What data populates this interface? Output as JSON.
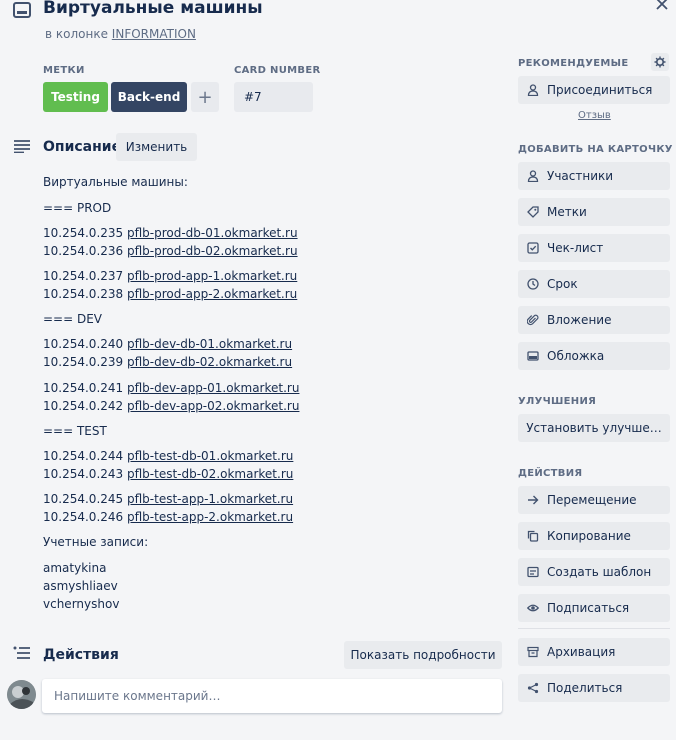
{
  "card": {
    "title": "Виртуальные машины",
    "list_prefix": "в колонке",
    "list_name": "INFORMATION"
  },
  "labels": {
    "header": "МЕТКИ",
    "items": [
      {
        "text": "Testing",
        "color": "#61bd4f"
      },
      {
        "text": "Back-end",
        "color": "#344563"
      }
    ],
    "add_symbol": "+"
  },
  "card_number": {
    "header": "CARD NUMBER",
    "value": "#7"
  },
  "description": {
    "title": "Описание",
    "edit_label": "Изменить",
    "intro": "Виртуальные машины:",
    "groups": [
      {
        "heading": "=== PROD",
        "blocks": [
          [
            {
              "ip": "10.254.0.235",
              "host": "pflb-prod-db-01.okmarket.ru"
            },
            {
              "ip": "10.254.0.236",
              "host": "pflb-prod-db-02.okmarket.ru"
            }
          ],
          [
            {
              "ip": "10.254.0.237",
              "host": "pflb-prod-app-1.okmarket.ru"
            },
            {
              "ip": "10.254.0.238",
              "host": "pflb-prod-app-2.okmarket.ru"
            }
          ]
        ]
      },
      {
        "heading": "=== DEV",
        "blocks": [
          [
            {
              "ip": "10.254.0.240",
              "host": "pflb-dev-db-01.okmarket.ru"
            },
            {
              "ip": "10.254.0.239",
              "host": "pflb-dev-db-02.okmarket.ru"
            }
          ],
          [
            {
              "ip": "10.254.0.241",
              "host": "pflb-dev-app-01.okmarket.ru"
            },
            {
              "ip": "10.254.0.242",
              "host": "pflb-dev-app-02.okmarket.ru"
            }
          ]
        ]
      },
      {
        "heading": "=== TEST",
        "blocks": [
          [
            {
              "ip": "10.254.0.244",
              "host": "pflb-test-db-01.okmarket.ru"
            },
            {
              "ip": "10.254.0.243",
              "host": "pflb-test-db-02.okmarket.ru"
            }
          ],
          [
            {
              "ip": "10.254.0.245",
              "host": "pflb-test-app-1.okmarket.ru"
            },
            {
              "ip": "10.254.0.246",
              "host": "pflb-test-app-2.okmarket.ru"
            }
          ]
        ]
      }
    ],
    "accounts_heading": "Учетные записи:",
    "accounts": [
      "amatykina",
      "asmyshliaev",
      "vchernyshov"
    ]
  },
  "activity": {
    "title": "Действия",
    "details_button": "Показать подробности",
    "comment_placeholder": "Напишите комментарий…"
  },
  "sidebar": {
    "suggested": {
      "header": "РЕКОМЕНДУЕМЫЕ",
      "join_label": "Присоединиться",
      "feedback_link": "Отзыв"
    },
    "add_to_card": {
      "header": "ДОБАВИТЬ НА КАРТОЧКУ",
      "items": [
        {
          "label": "Участники",
          "icon": "person-icon"
        },
        {
          "label": "Метки",
          "icon": "tag-icon"
        },
        {
          "label": "Чек-лист",
          "icon": "checklist-icon"
        },
        {
          "label": "Срок",
          "icon": "clock-icon"
        },
        {
          "label": "Вложение",
          "icon": "paperclip-icon"
        },
        {
          "label": "Обложка",
          "icon": "cover-icon"
        }
      ]
    },
    "powerups": {
      "header": "УЛУЧШЕНИЯ",
      "install_label": "Установить улучше…"
    },
    "actions": {
      "header": "ДЕЙСТВИЯ",
      "items": [
        {
          "label": "Перемещение",
          "icon": "arrow-right-icon"
        },
        {
          "label": "Копирование",
          "icon": "copy-icon"
        },
        {
          "label": "Создать шаблон",
          "icon": "template-icon"
        },
        {
          "label": "Подписаться",
          "icon": "eye-icon"
        }
      ],
      "archive_label": "Архивация",
      "share_label": "Поделиться"
    }
  },
  "colors": {
    "background": "#f4f5f7",
    "button": "#e9ebee",
    "text": "#172b4d",
    "muted": "#5e6c84",
    "label_green": "#61bd4f",
    "label_dark": "#344563"
  }
}
